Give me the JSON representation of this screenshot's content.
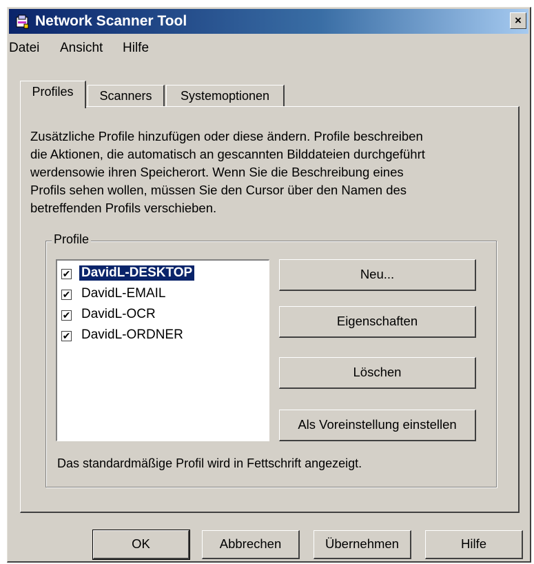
{
  "window": {
    "title": "Network Scanner Tool",
    "close_label": "×"
  },
  "menu": [
    "Datei",
    "Ansicht",
    "Hilfe"
  ],
  "tabs": [
    {
      "label": "Profiles",
      "active": true
    },
    {
      "label": "Scanners",
      "active": false
    },
    {
      "label": "Systemoptionen",
      "active": false
    }
  ],
  "description_lines": [
    "Zusätzliche Profile hinzufügen oder diese ändern. Profile beschreiben",
    "die Aktionen, die automatisch an gescannten Bilddateien durchgeführt",
    "werdensowie ihren Speicherort. Wenn Sie die Beschreibung eines",
    "Profils sehen wollen, müssen Sie den Cursor über den Namen des",
    "betreffenden Profils verschieben."
  ],
  "group": {
    "label": "Profile",
    "profiles": [
      {
        "name": "DavidL-DESKTOP",
        "checked": true,
        "default": true
      },
      {
        "name": "DavidL-EMAIL",
        "checked": true,
        "default": false
      },
      {
        "name": "DavidL-OCR",
        "checked": true,
        "default": false
      },
      {
        "name": "DavidL-ORDNER",
        "checked": true,
        "default": false
      }
    ],
    "buttons": {
      "new": "Neu...",
      "properties": "Eigenschaften",
      "delete": "Löschen",
      "set_default": "Als Voreinstellung einstellen"
    },
    "hint": "Das standardmäßige Profil wird in Fettschrift angezeigt."
  },
  "footer": {
    "ok": "OK",
    "cancel": "Abbrechen",
    "apply": "Übernehmen",
    "help": "Hilfe"
  },
  "colors": {
    "selection": "#0a246a",
    "face": "#d4d0c8"
  }
}
